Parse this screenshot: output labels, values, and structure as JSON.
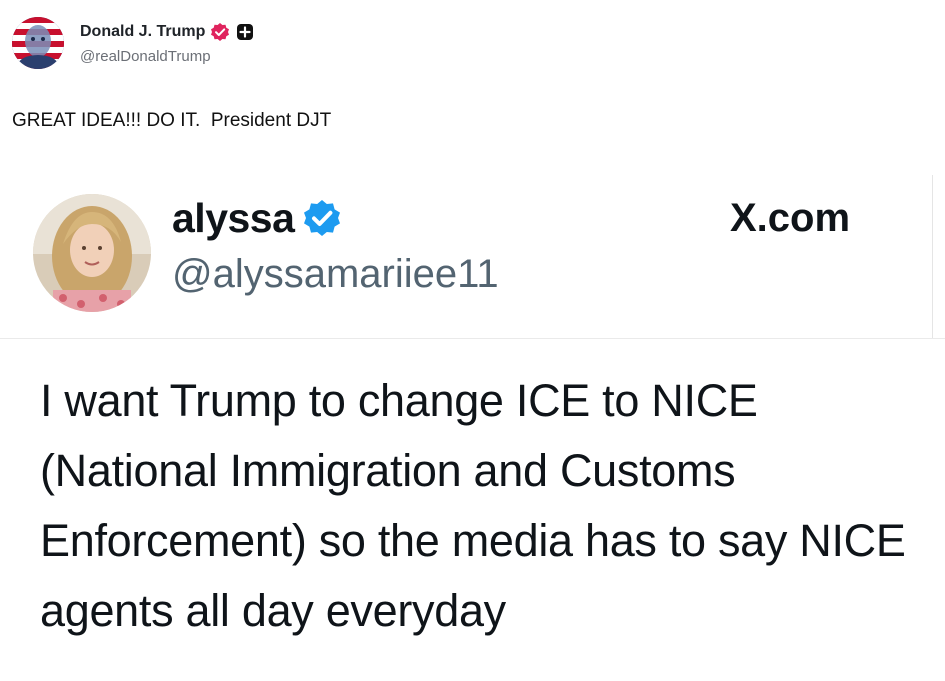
{
  "post": {
    "author_name": "Donald J. Trump",
    "author_handle": "@realDonaldTrump",
    "text": "GREAT IDEA!!! DO IT.  President DJT",
    "icons": {
      "avatar": "avatar-flag-portrait",
      "verified": "verified-badge-icon",
      "plus": "plus-badge-icon"
    }
  },
  "quoted": {
    "name": "alyssa",
    "handle": "@alyssamariiee11",
    "source": "X.com",
    "text": "I want Trump to change ICE to NICE (National Immigration and Customs Enforcement) so the media has to say NICE agents all day everyday",
    "icons": {
      "avatar": "avatar-portrait",
      "verified": "verified-check-icon",
      "brand": "x-logo-icon"
    }
  },
  "colors": {
    "verified_main": "#e0245e",
    "verified_quoted": "#1d9bf0",
    "text": "#0f1419",
    "muted": "#536471"
  }
}
